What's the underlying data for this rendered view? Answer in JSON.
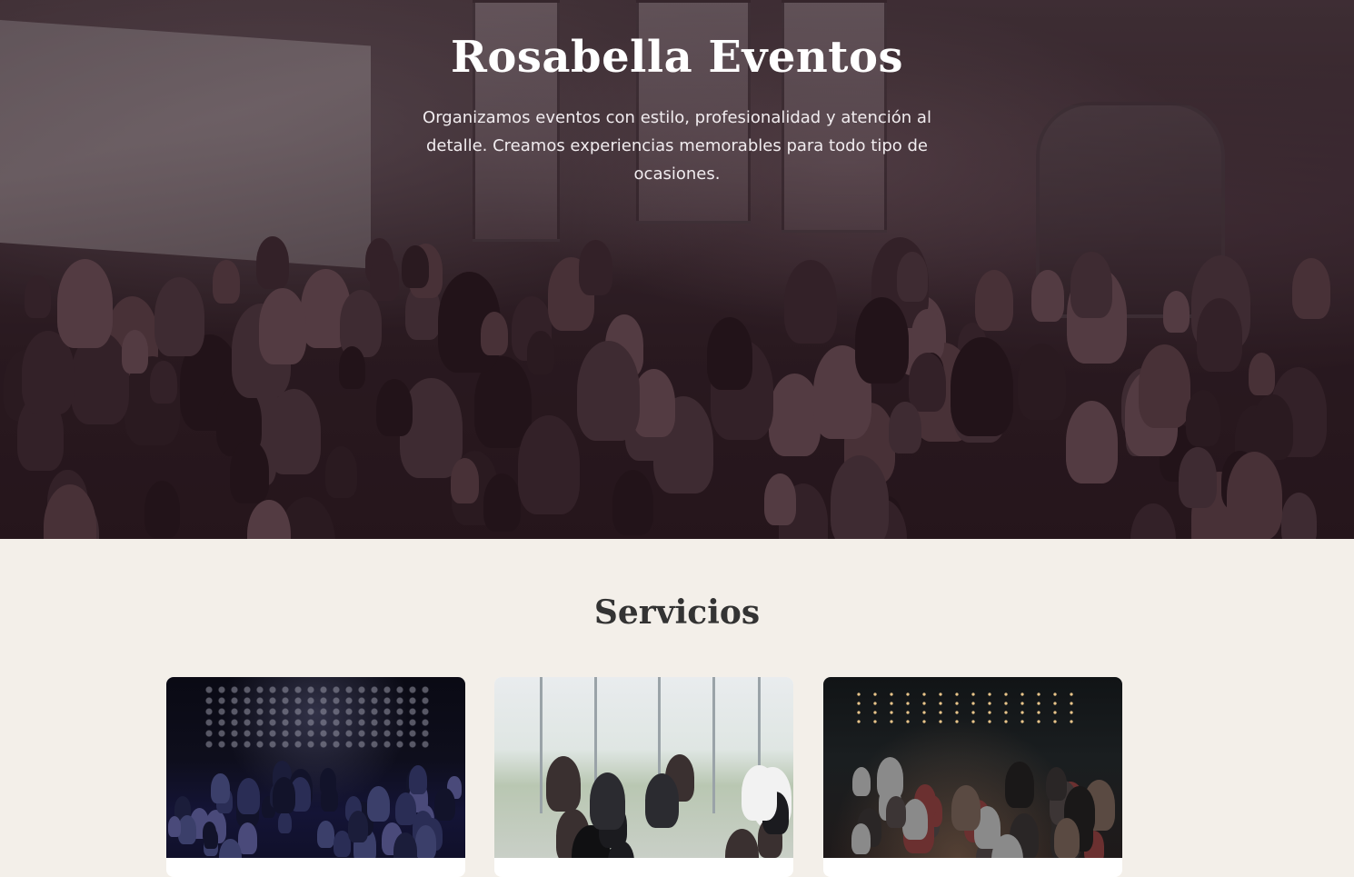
{
  "hero": {
    "title": "Rosabella Eventos",
    "tagline": "Organizamos eventos con estilo, profesionalidad y atención al detalle. Creamos experiencias memorables para todo tipo de ocasiones."
  },
  "services": {
    "title": "Servicios",
    "cards": [
      {
        "image": "conference-audience-photo"
      },
      {
        "image": "speaker-presentation-photo"
      },
      {
        "image": "night-party-photo"
      }
    ]
  },
  "colors": {
    "page_background": "#f3efe9",
    "heading_text": "#333333",
    "hero_text": "#ffffff"
  }
}
